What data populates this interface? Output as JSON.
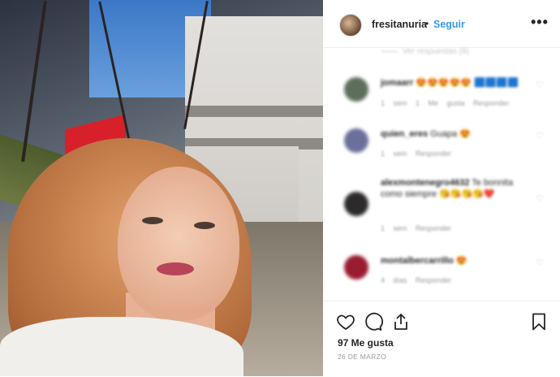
{
  "header": {
    "username": "fresitanuria",
    "separator": "•",
    "follow_label": "Seguir",
    "more_icon": "ellipsis-icon"
  },
  "comments": {
    "view_replies": "Ver respuestas (8)",
    "items": [
      {
        "username": "jomaarr",
        "text": "😍😍😍😍😍 🟦🟦🟦🟦",
        "meta": "1 sem   1 Me gusta   Responder",
        "avatar_color": "#5d6e5a"
      },
      {
        "username": "quien_eres",
        "text": "Guapa 😍",
        "meta": "1 sem   Responder",
        "avatar_color": "#6b6f9a"
      },
      {
        "username": "alexmontenegro4632",
        "text": "Te bonnita como siempre 😘😘😘😘❤️",
        "meta": "1 sem   Responder",
        "avatar_color": "#2c2a2a"
      },
      {
        "username": "montalbercarrillo",
        "text": "😍",
        "meta": "4 días   Responder",
        "avatar_color": "#9a1c30"
      }
    ]
  },
  "actions": {
    "like_icon": "heart-icon",
    "comment_icon": "comment-icon",
    "share_icon": "share-icon",
    "save_icon": "bookmark-icon",
    "likes": "97 Me gusta",
    "date": "26 DE MARZO"
  },
  "colors": {
    "link": "#3897f0",
    "text": "#262626",
    "muted": "#999999",
    "border": "#efefef"
  }
}
